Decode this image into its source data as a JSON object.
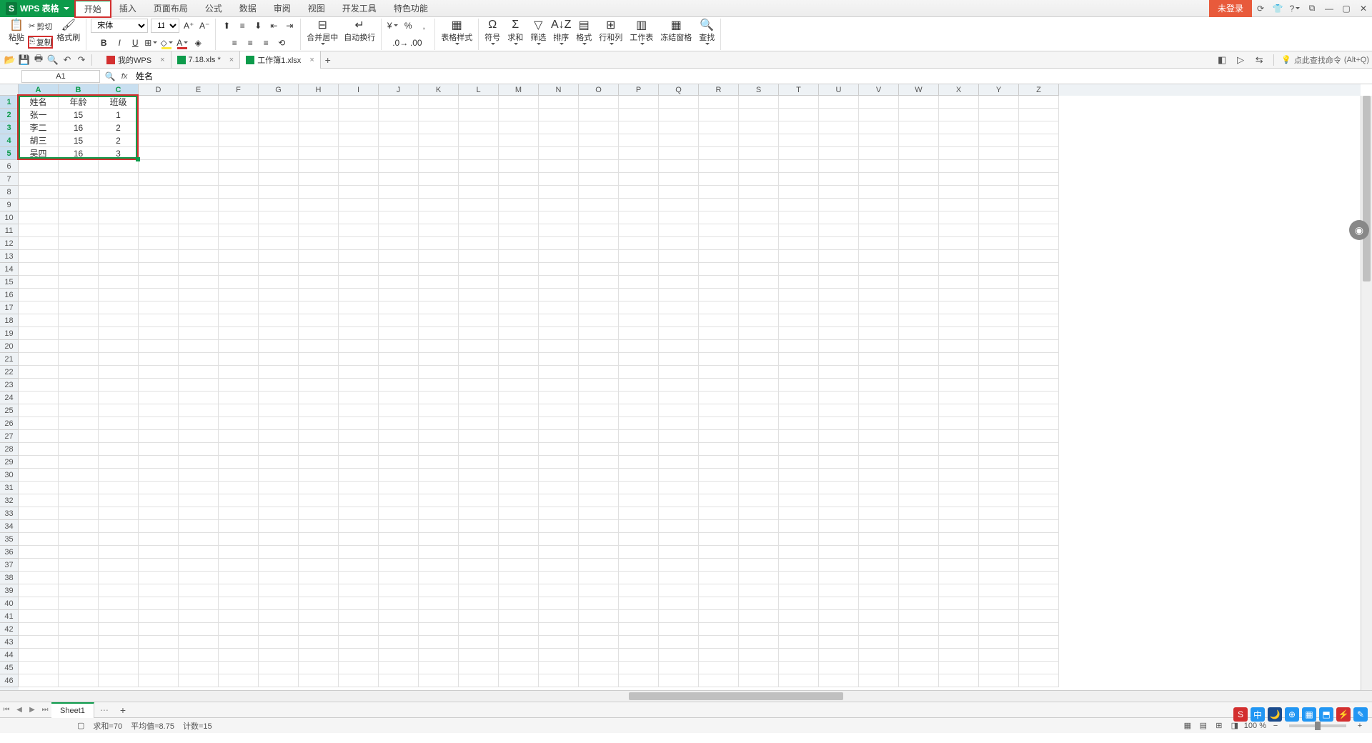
{
  "app": {
    "name": "WPS 表格"
  },
  "menu": {
    "tabs": [
      "开始",
      "插入",
      "页面布局",
      "公式",
      "数据",
      "审阅",
      "视图",
      "开发工具",
      "特色功能"
    ],
    "active_index": 0
  },
  "title_right": {
    "login": "未登录",
    "icons": [
      "globe",
      "tshirt",
      "help",
      "window",
      "min",
      "max",
      "close"
    ]
  },
  "ribbon": {
    "paste": "粘贴",
    "cut": "剪切",
    "copy": "复制",
    "format_painter": "格式刷",
    "font_name": "宋体",
    "font_size": "11",
    "merge_center": "合并居中",
    "wrap_text": "自动换行",
    "table_style": "表格样式",
    "symbol": "符号",
    "sum": "求和",
    "filter": "筛选",
    "sort": "排序",
    "format": "格式",
    "row_col": "行和列",
    "worksheet": "工作表",
    "freeze": "冻结窗格",
    "find": "查找"
  },
  "quick_access": {
    "icons": [
      "open",
      "save",
      "print",
      "print-preview",
      "undo",
      "redo"
    ]
  },
  "doc_tabs": [
    {
      "icon": "wps",
      "label": "我的WPS",
      "closable": true,
      "active": false
    },
    {
      "icon": "xls",
      "label": "7.18.xls *",
      "closable": true,
      "active": false
    },
    {
      "icon": "xls",
      "label": "工作簿1.xlsx",
      "closable": true,
      "active": true
    }
  ],
  "search_cmd": {
    "placeholder": "点此查找命令",
    "shortcut": "(Alt+Q)"
  },
  "formula_bar": {
    "name_box": "A1",
    "value": "姓名"
  },
  "columns": [
    "A",
    "B",
    "C",
    "D",
    "E",
    "F",
    "G",
    "H",
    "I",
    "J",
    "K",
    "L",
    "M",
    "N",
    "O",
    "P",
    "Q",
    "R",
    "S",
    "T",
    "U",
    "V",
    "W",
    "X",
    "Y",
    "Z"
  ],
  "col_widths": {
    "default": 56,
    "ABC": 56
  },
  "visible_rows": 46,
  "selected_rows": [
    1,
    2,
    3,
    4,
    5
  ],
  "selected_cols": [
    0,
    1,
    2
  ],
  "data": {
    "headers": [
      "姓名",
      "年龄",
      "班级"
    ],
    "rows": [
      [
        "张一",
        "15",
        "1"
      ],
      [
        "李二",
        "16",
        "2"
      ],
      [
        "胡三",
        "15",
        "2"
      ],
      [
        "吴四",
        "16",
        "3"
      ]
    ]
  },
  "sheet_tabs": {
    "active": "Sheet1",
    "tabs": [
      "Sheet1"
    ]
  },
  "status": {
    "sum_label": "求和=",
    "sum": "70",
    "avg_label": "平均值=",
    "avg": "8.75",
    "count_label": "计数=",
    "count": "15",
    "zoom": "100 %"
  },
  "tray_icons": [
    {
      "bg": "#d32f2f",
      "t": "S"
    },
    {
      "bg": "#2196f3",
      "t": "中"
    },
    {
      "bg": "#1a4b8c",
      "t": "🌙"
    },
    {
      "bg": "#2196f3",
      "t": "⊕"
    },
    {
      "bg": "#2196f3",
      "t": "▦"
    },
    {
      "bg": "#2196f3",
      "t": "⬒"
    },
    {
      "bg": "#d32f2f",
      "t": "⚡"
    },
    {
      "bg": "#2196f3",
      "t": "✎"
    }
  ]
}
